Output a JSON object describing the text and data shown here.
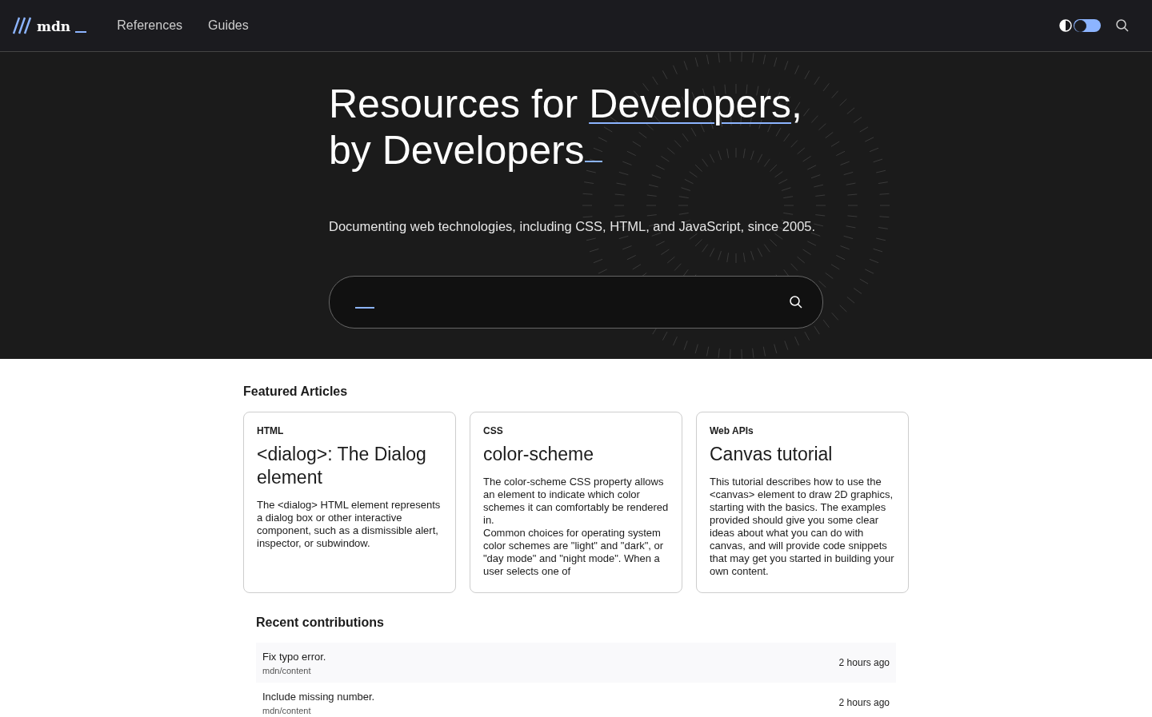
{
  "header": {
    "logo": "mdn",
    "nav": [
      "References",
      "Guides"
    ],
    "theme_switch": {
      "on": true
    }
  },
  "hero": {
    "headline": {
      "prefix": "Resources for ",
      "highlight": "Developers",
      "suffix": ",",
      "line2": "by Developers"
    },
    "tagline": "Documenting web technologies, including CSS, HTML, and JavaScript, since 2005."
  },
  "featured": {
    "title": "Featured Articles",
    "articles": [
      {
        "category": "HTML",
        "title": "<dialog>: The Dialog element",
        "summary": "The <dialog> HTML element represents a dialog box or other interactive component, such as a dismissible alert, inspector, or subwindow."
      },
      {
        "category": "CSS",
        "title": "color-scheme",
        "summary": "The color-scheme CSS property allows an element to indicate which color schemes it can comfortably be rendered in.\nCommon choices for operating system color schemes are \"light\" and \"dark\", or \"day mode\" and \"night mode\". When a user selects one of"
      },
      {
        "category": "Web APIs",
        "title": "Canvas tutorial",
        "summary": "This tutorial describes how to use the <canvas> element to draw 2D graphics, starting with the basics. The examples provided should give you some clear ideas about what you can do with canvas, and will provide code snippets that may get you started in building your own content."
      }
    ]
  },
  "recent": {
    "title": "Recent contributions",
    "items": [
      {
        "message": "Fix typo error.",
        "repo": "mdn/content",
        "time": "2 hours ago"
      },
      {
        "message": "Include missing number.",
        "repo": "mdn/content",
        "time": "2 hours ago"
      }
    ]
  }
}
